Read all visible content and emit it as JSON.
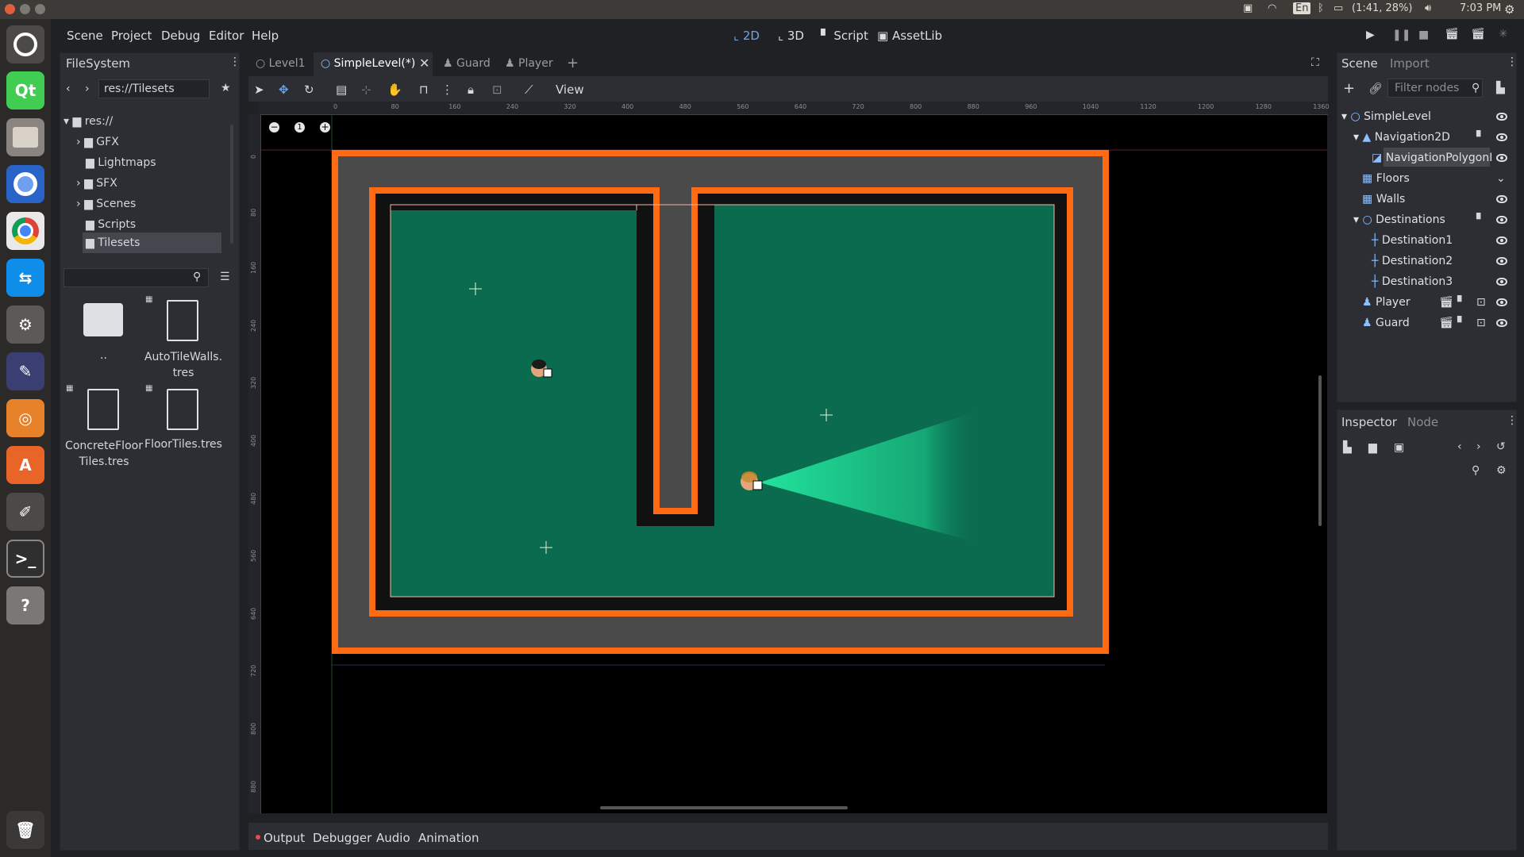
{
  "os": {
    "tray_keyboard": "En",
    "battery": "(1:41, 28%)",
    "clock": "7:03 PM",
    "launcher_icons": [
      "ubuntu-icon",
      "qt-creator-icon",
      "files-icon",
      "chromium-icon",
      "chrome-icon",
      "teamviewer-icon",
      "settings-icon",
      "inkscape-icon",
      "blender-icon",
      "software-center-icon",
      "gimp-icon",
      "terminal-icon",
      "help-icon",
      "trash-icon"
    ]
  },
  "menu": {
    "scene": "Scene",
    "project": "Project",
    "debug": "Debug",
    "editor": "Editor",
    "help": "Help"
  },
  "workspaces": {
    "two_d": "2D",
    "three_d": "3D",
    "script": "Script",
    "assetlib": "AssetLib"
  },
  "filesystem": {
    "title": "FileSystem",
    "path": "res://Tilesets",
    "tree": [
      "res://",
      "GFX",
      "Lightmaps",
      "SFX",
      "Scenes",
      "Scripts",
      "Tilesets"
    ],
    "files": [
      {
        "name": "..",
        "type": "folder"
      },
      {
        "name": "AutoTileWalls.tres",
        "type": "file"
      },
      {
        "name": "ConcreteFloorTiles.tres",
        "type": "file"
      },
      {
        "name": "FloorTiles.tres",
        "type": "file"
      }
    ]
  },
  "tabs": [
    "Level1",
    "SimpleLevel(*)",
    "Guard",
    "Player"
  ],
  "toolbar": {
    "view": "View"
  },
  "zoom_reset": "1",
  "ruler_h": [
    "0",
    "80",
    "160",
    "240",
    "320",
    "400",
    "480",
    "560",
    "640",
    "720",
    "800",
    "880",
    "960",
    "1040",
    "1120",
    "1200",
    "1280",
    "1360"
  ],
  "ruler_v": [
    "0",
    "80",
    "160",
    "240",
    "320",
    "400",
    "480",
    "560",
    "640",
    "720",
    "800",
    "880"
  ],
  "scene_dock": {
    "scene_tab": "Scene",
    "import_tab": "Import",
    "filter_placeholder": "Filter nodes",
    "nodes": [
      "SimpleLevel",
      "Navigation2D",
      "NavigationPolygonI",
      "Floors",
      "Walls",
      "Destinations",
      "Destination1",
      "Destination2",
      "Destination3",
      "Player",
      "Guard"
    ]
  },
  "inspector": {
    "inspector_tab": "Inspector",
    "node_tab": "Node"
  },
  "bottom": {
    "output": "Output",
    "debugger": "Debugger",
    "audio": "Audio",
    "animation": "Animation"
  },
  "colors": {
    "accent": "#6fa3ec",
    "wall_orange": "#ff6a13",
    "floor_green": "#0b6b4e",
    "cone_green": "#1fd897",
    "road_gray": "#4a4a4a"
  }
}
